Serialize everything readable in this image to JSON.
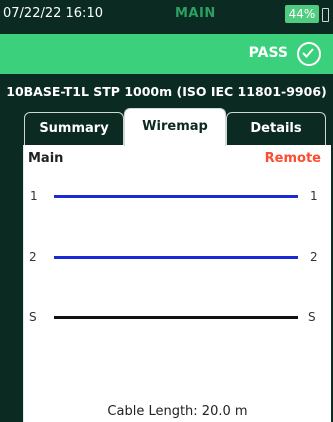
{
  "status": {
    "time": "07/22/22 16:10",
    "mode": "MAIN",
    "battery": "44%"
  },
  "result": {
    "label": "PASS",
    "icon": "check-circle-icon",
    "color": "#3ad07c"
  },
  "test_name": "10BASE-T1L STP 1000m (ISO IEC 11801-9906)",
  "tabs": [
    {
      "label": "Summary",
      "active": false
    },
    {
      "label": "Wiremap",
      "active": true
    },
    {
      "label": "Details",
      "active": false
    }
  ],
  "wiremap": {
    "main_label": "Main",
    "remote_label": "Remote",
    "wires": [
      {
        "main": "1",
        "remote": "1",
        "color": "#1a2bd6"
      },
      {
        "main": "2",
        "remote": "2",
        "color": "#1a2bd6"
      },
      {
        "main": "S",
        "remote": "S",
        "color": "#111111"
      }
    ],
    "cable_length": "Cable Length: 20.0 m"
  }
}
